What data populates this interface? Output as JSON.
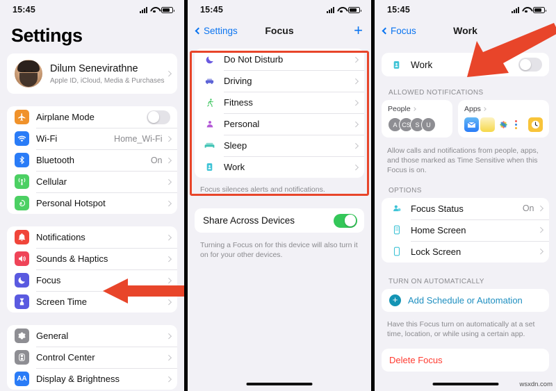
{
  "statusbar": {
    "time": "15:45"
  },
  "panel1": {
    "title": "Settings",
    "profile": {
      "name": "Dilum Senevirathne",
      "subtitle": "Apple ID, iCloud, Media & Purchases"
    },
    "group_connectivity": [
      {
        "label": "Airplane Mode",
        "icon": "airplane-icon",
        "color": "#f0922b",
        "control": "toggle",
        "toggle_on": false
      },
      {
        "label": "Wi-Fi",
        "icon": "wifi-icon",
        "color": "#2a7cf7",
        "value": "Home_Wi-Fi"
      },
      {
        "label": "Bluetooth",
        "icon": "bluetooth-icon",
        "color": "#2a7cf7",
        "value": "On"
      },
      {
        "label": "Cellular",
        "icon": "cellular-icon",
        "color": "#4cd063"
      },
      {
        "label": "Personal Hotspot",
        "icon": "hotspot-icon",
        "color": "#4cd063"
      }
    ],
    "group_alerts": [
      {
        "label": "Notifications",
        "icon": "bell-icon",
        "color": "#f0453a"
      },
      {
        "label": "Sounds & Haptics",
        "icon": "speaker-icon",
        "color": "#ef4458"
      },
      {
        "label": "Focus",
        "icon": "moon-icon",
        "color": "#5a5ae0"
      },
      {
        "label": "Screen Time",
        "icon": "hourglass-icon",
        "color": "#5a5ae0"
      }
    ],
    "group_system": [
      {
        "label": "General",
        "icon": "gear-icon",
        "color": "#8e8e93"
      },
      {
        "label": "Control Center",
        "icon": "sliders-icon",
        "color": "#8e8e93"
      },
      {
        "label": "Display & Brightness",
        "icon": "text-size-icon",
        "color": "#2a7cf7"
      }
    ]
  },
  "panel2": {
    "nav": {
      "back": "Settings",
      "title": "Focus",
      "add": "+"
    },
    "focus_modes": [
      {
        "label": "Do Not Disturb",
        "icon": "moon-icon",
        "color": "#6a5ae0"
      },
      {
        "label": "Driving",
        "icon": "car-icon",
        "color": "#5b62d6"
      },
      {
        "label": "Fitness",
        "icon": "running-icon",
        "color": "#41c662"
      },
      {
        "label": "Personal",
        "icon": "person-icon",
        "color": "#b45ad6"
      },
      {
        "label": "Sleep",
        "icon": "bed-icon",
        "color": "#3ec3b4"
      },
      {
        "label": "Work",
        "icon": "badge-icon",
        "color": "#3ec3d6"
      }
    ],
    "focus_footnote": "Focus silences alerts and notifications.",
    "share_row": {
      "label": "Share Across Devices",
      "toggle_on": true
    },
    "share_footnote": "Turning a Focus on for this device will also turn it on for your other devices."
  },
  "panel3": {
    "nav": {
      "back": "Focus",
      "title": "Work"
    },
    "focus_toggle_row": {
      "label": "Work",
      "icon": "badge-icon",
      "color": "#3ec3d6",
      "toggle_on": false
    },
    "allowed_header": "ALLOWED NOTIFICATIONS",
    "people_card": {
      "title": "People",
      "avatars": [
        "A",
        "CS",
        "S",
        "U"
      ]
    },
    "apps_card": {
      "title": "Apps",
      "apps": [
        "mail-app-icon",
        "photos-app-icon",
        "reminders-app-icon",
        "clock-app-icon"
      ]
    },
    "allowed_footnote": "Allow calls and notifications from people, apps, and those marked as Time Sensitive when this Focus is on.",
    "options_header": "OPTIONS",
    "options": [
      {
        "label": "Focus Status",
        "icon": "focus-status-icon",
        "color": "#3ec3d6",
        "value": "On"
      },
      {
        "label": "Home Screen",
        "icon": "home-screen-icon",
        "color": "#3ec3d6",
        "value": ""
      },
      {
        "label": "Lock Screen",
        "icon": "lock-screen-icon",
        "color": "#3ec3d6",
        "value": ""
      }
    ],
    "auto_header": "TURN ON AUTOMATICALLY",
    "add_schedule": "Add Schedule or Automation",
    "auto_footnote": "Have this Focus turn on automatically at a set time, location, or while using a certain app.",
    "delete": "Delete Focus"
  },
  "annotations": {
    "highlight_color": "#e8452a",
    "arrow_color": "#e8452a",
    "watermark": "wsxdn.com"
  }
}
